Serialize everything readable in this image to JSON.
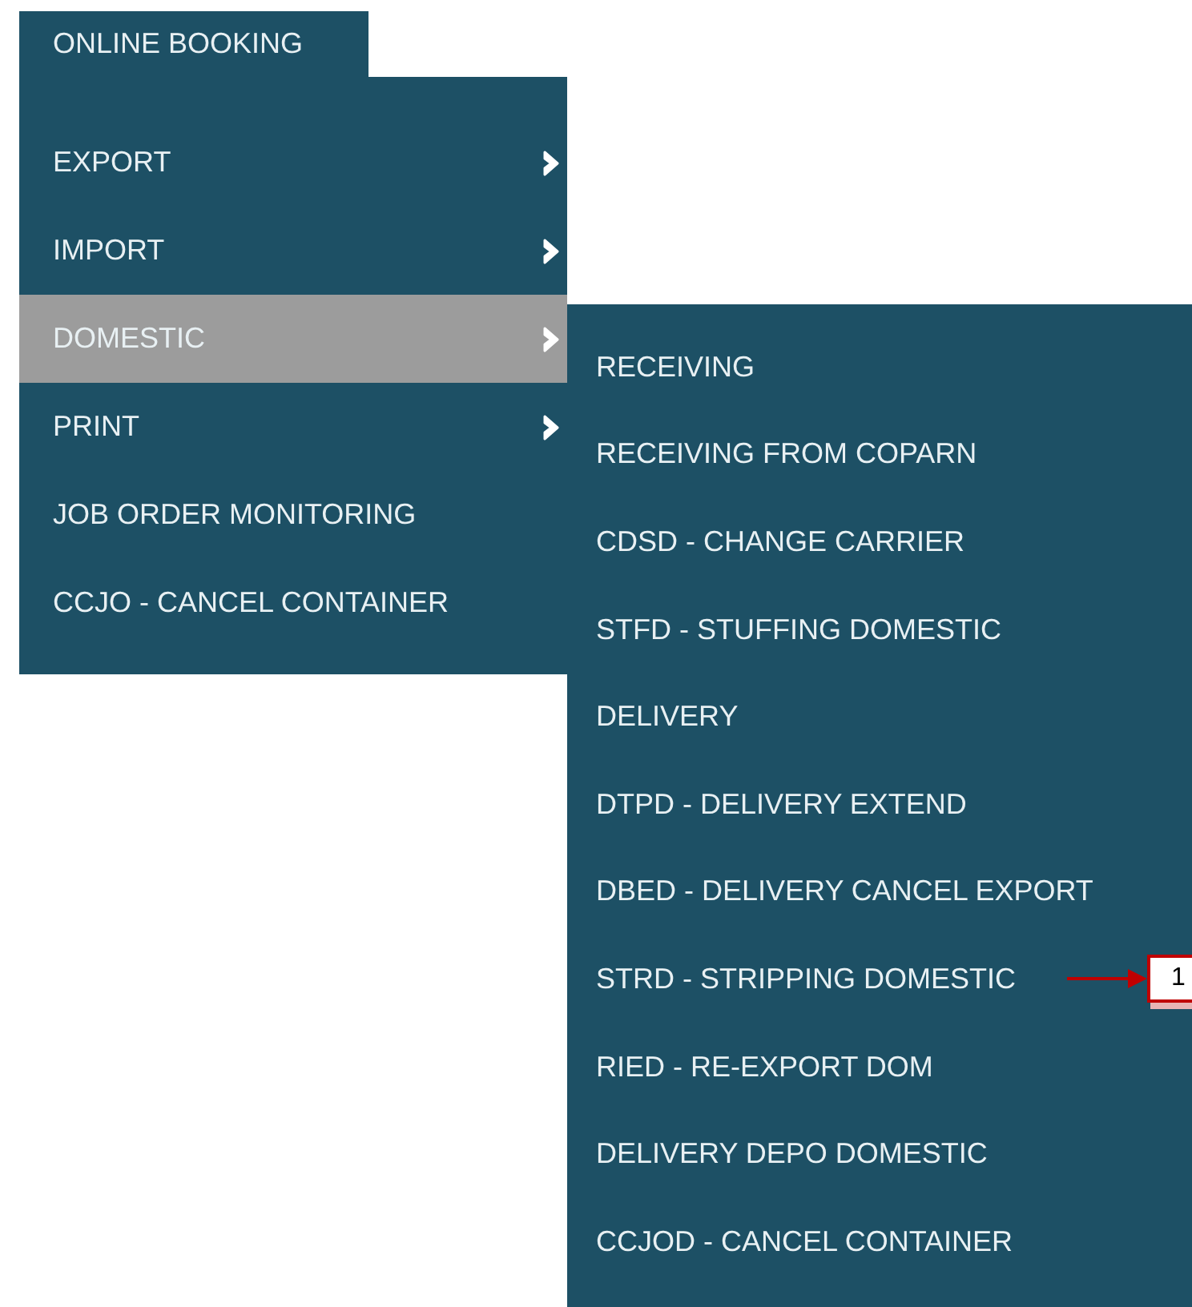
{
  "tab": {
    "label": "ONLINE BOOKING"
  },
  "menu": [
    {
      "label": "EXPORT",
      "has_submenu": true,
      "selected": false
    },
    {
      "label": "IMPORT",
      "has_submenu": true,
      "selected": false
    },
    {
      "label": "DOMESTIC",
      "has_submenu": true,
      "selected": true
    },
    {
      "label": "PRINT",
      "has_submenu": true,
      "selected": false
    },
    {
      "label": "JOB ORDER MONITORING",
      "has_submenu": false,
      "selected": false
    },
    {
      "label": "CCJO - CANCEL CONTAINER",
      "has_submenu": false,
      "selected": false
    }
  ],
  "submenu": [
    {
      "label": "RECEIVING"
    },
    {
      "label": "RECEIVING FROM COPARN"
    },
    {
      "label": "CDSD - CHANGE CARRIER"
    },
    {
      "label": "STFD - STUFFING DOMESTIC"
    },
    {
      "label": "DELIVERY"
    },
    {
      "label": "DTPD - DELIVERY EXTEND"
    },
    {
      "label": "DBED - DELIVERY CANCEL EXPORT"
    },
    {
      "label": "STRD - STRIPPING DOMESTIC",
      "callout": "1"
    },
    {
      "label": "RIED - RE-EXPORT DOM"
    },
    {
      "label": "DELIVERY DEPO DOMESTIC"
    },
    {
      "label": "CCJOD - CANCEL CONTAINER"
    }
  ]
}
